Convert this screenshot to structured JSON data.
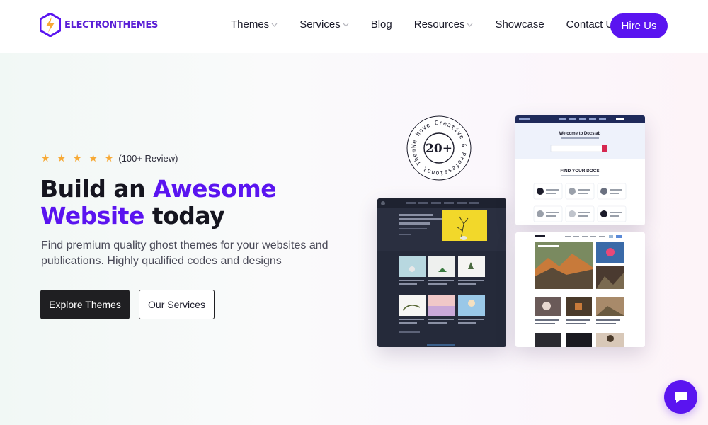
{
  "brand": {
    "name": "ELECTRONTHEMES",
    "color": "#5a14f0"
  },
  "nav": {
    "items": [
      {
        "label": "Themes",
        "has_dropdown": true
      },
      {
        "label": "Services",
        "has_dropdown": true
      },
      {
        "label": "Blog",
        "has_dropdown": false
      },
      {
        "label": "Resources",
        "has_dropdown": true
      },
      {
        "label": "Showcase",
        "has_dropdown": false
      },
      {
        "label": "Contact Us",
        "has_dropdown": false
      }
    ],
    "cta_label": "Hire Us"
  },
  "hero": {
    "stars": "★ ★ ★ ★ ★",
    "rating_value": 5,
    "review_text": "(100+ Review)",
    "headline_part1": "Build an ",
    "headline_accent1": "Awesome",
    "headline_accent2": "Website",
    "headline_part2": " today",
    "subtext": "Find premium quality ghost themes for your websites and publications. Highly qualified codes and designs",
    "primary_button": "Explore Themes",
    "secondary_button": "Our Services"
  },
  "badge": {
    "ring_text": "We have Creative & Professional Theme",
    "count": "20+"
  },
  "previews": {
    "docs_title": "FIND YOUR DOCS",
    "docs_welcome": "Welcome to Docslab"
  },
  "colors": {
    "accent": "#5a14f0",
    "star": "#f7a935",
    "dark_button": "#1f1f22"
  },
  "icons": {
    "chat": "chat-bubble-icon",
    "chevron": "chevron-down-icon",
    "logo": "bolt-logo-icon"
  }
}
